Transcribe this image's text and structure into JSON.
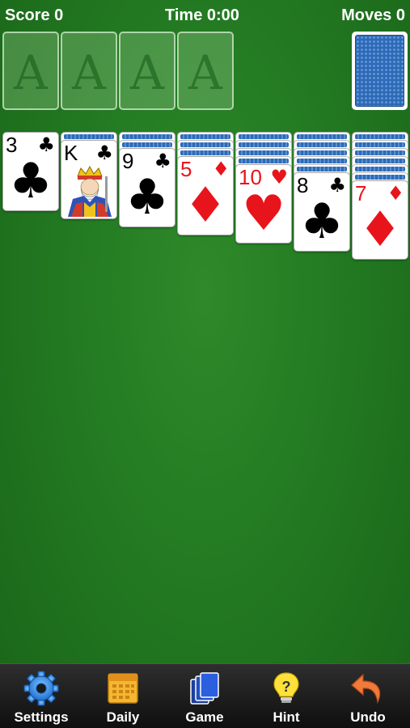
{
  "status": {
    "score": "Score 0",
    "time": "Time 0:00",
    "moves": "Moves 0"
  },
  "foundations": [
    {
      "label": "A"
    },
    {
      "label": "A"
    },
    {
      "label": "A"
    },
    {
      "label": "A"
    }
  ],
  "tableau": [
    {
      "face_down": 0,
      "card": {
        "rank": "3",
        "suit": "♣",
        "color": "black"
      }
    },
    {
      "face_down": 1,
      "card": {
        "rank": "K",
        "suit": "♣",
        "color": "black"
      }
    },
    {
      "face_down": 2,
      "card": {
        "rank": "9",
        "suit": "♣",
        "color": "black"
      }
    },
    {
      "face_down": 3,
      "card": {
        "rank": "5",
        "suit": "♦",
        "color": "red"
      }
    },
    {
      "face_down": 4,
      "card": {
        "rank": "10",
        "suit": "♥",
        "color": "red"
      }
    },
    {
      "face_down": 5,
      "card": {
        "rank": "8",
        "suit": "♣",
        "color": "black"
      }
    },
    {
      "face_down": 6,
      "card": {
        "rank": "7",
        "suit": "♦",
        "color": "red"
      }
    }
  ],
  "toolbar": {
    "settings": "Settings",
    "daily": "Daily",
    "game": "Game",
    "hint": "Hint",
    "undo": "Undo"
  },
  "colors": {
    "felt": "#237a22",
    "card_back": "#2d6bb8",
    "red_suit": "#e8141b",
    "toolbar_bg": "#1a1a1a"
  }
}
